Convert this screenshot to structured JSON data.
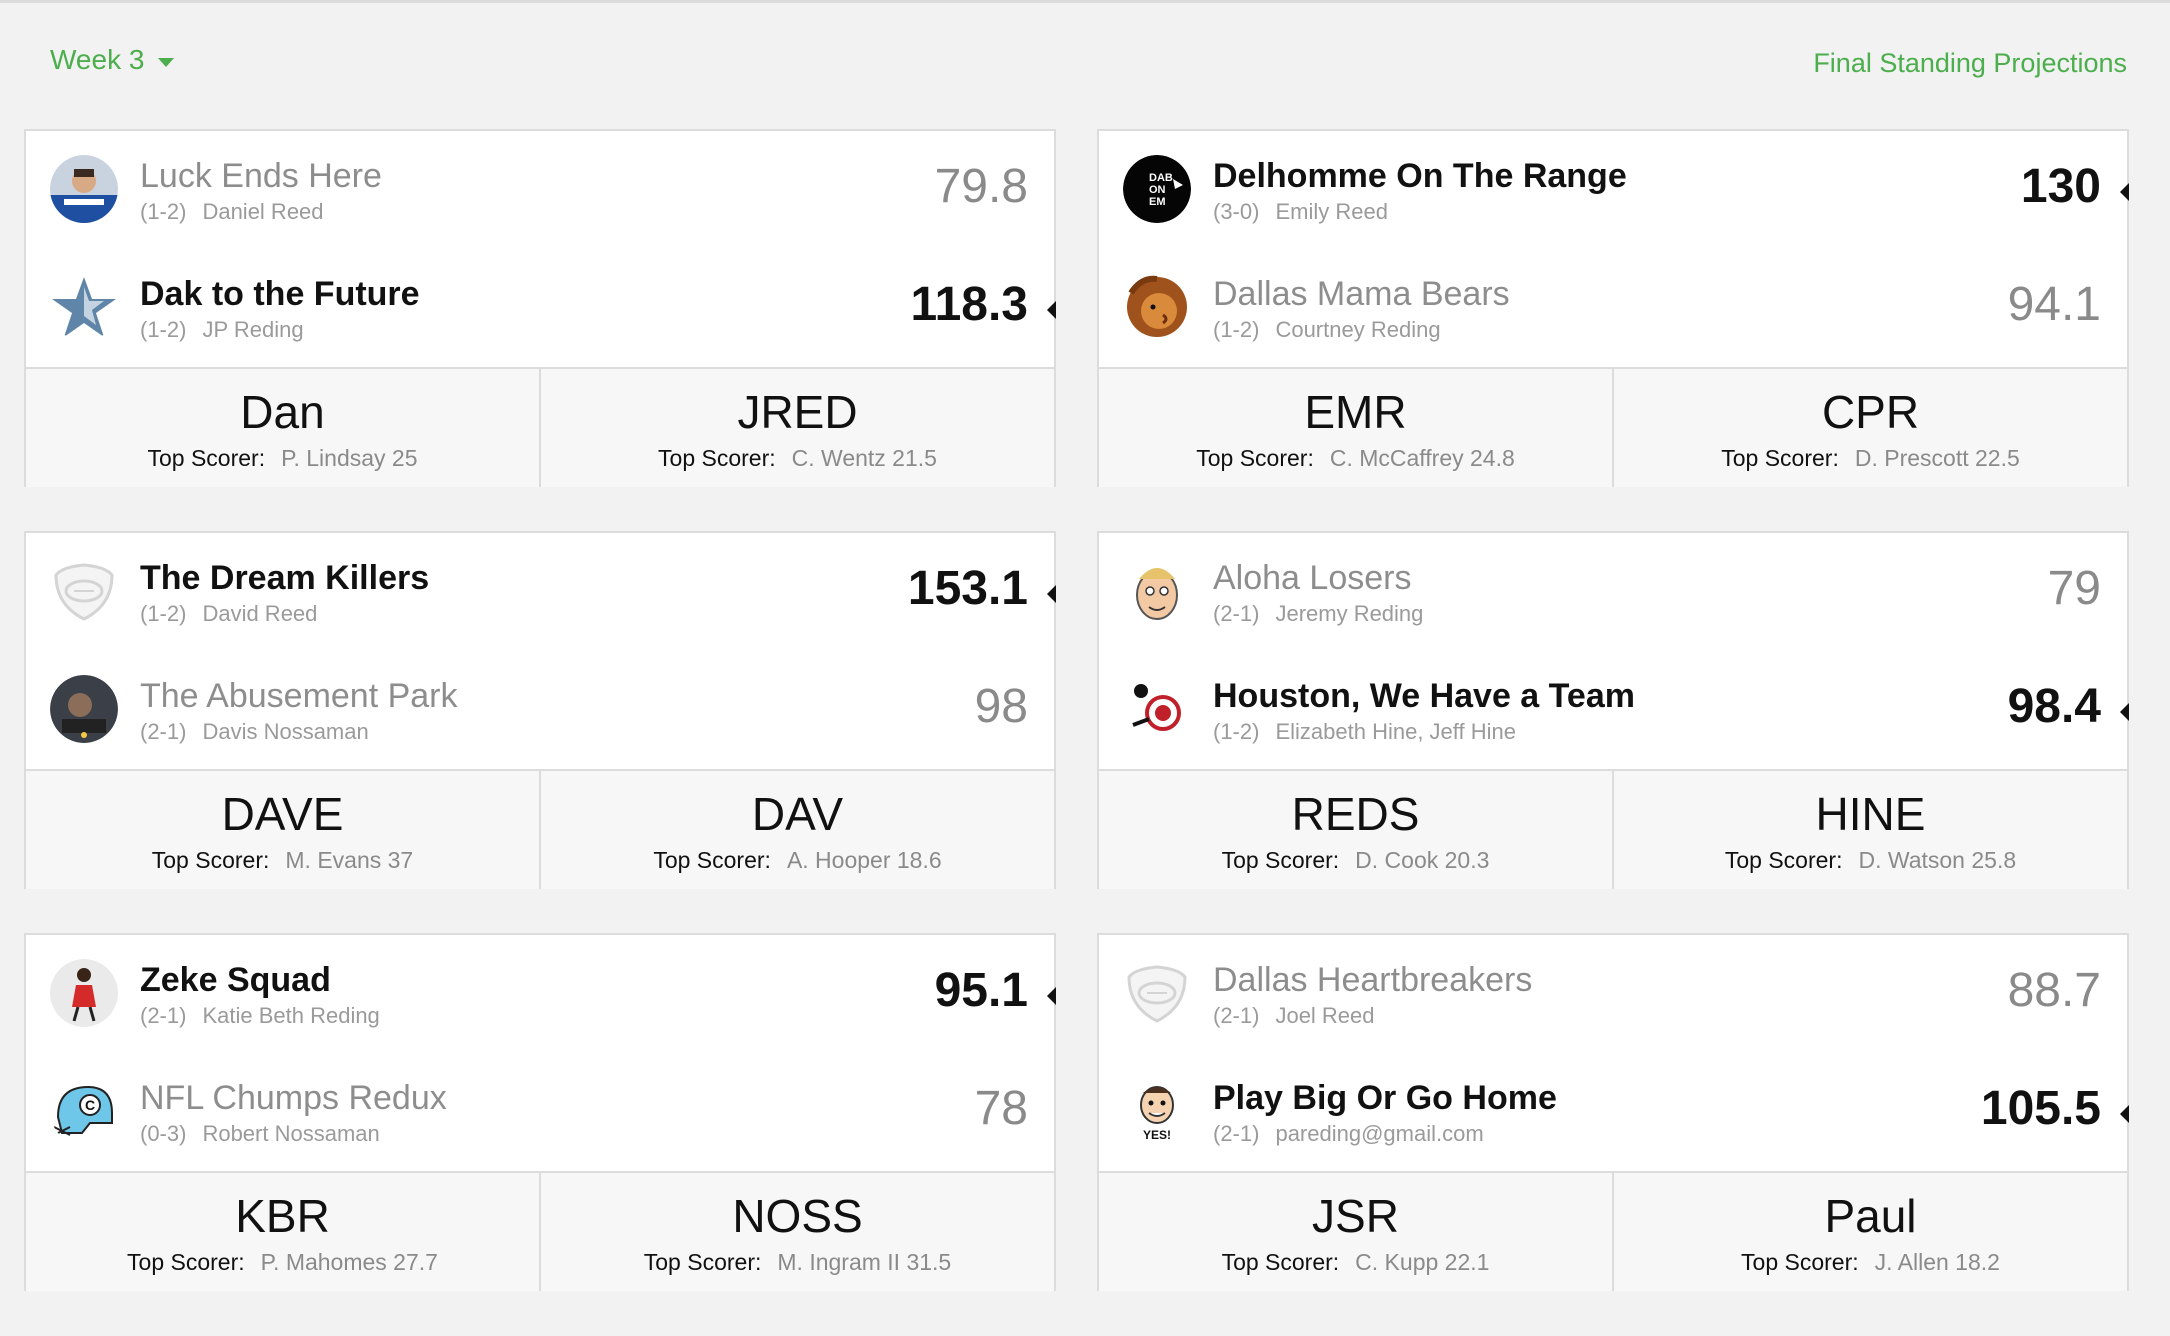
{
  "header": {
    "week_label": "Week 3",
    "projections_link": "Final Standing Projections"
  },
  "top_scorer_label": "Top Scorer:",
  "matchups": [
    {
      "team1": {
        "name": "Luck Ends Here",
        "record": "(1-2)",
        "owner": "Daniel Reed",
        "score": "79.8",
        "winner": false,
        "avatar": "quarterback-photo"
      },
      "team2": {
        "name": "Dak to the Future",
        "record": "(1-2)",
        "owner": "JP Reding",
        "score": "118.3",
        "winner": true,
        "avatar": "star-logo"
      },
      "footer1": {
        "abbr": "Dan",
        "top_scorer": "P. Lindsay 25"
      },
      "footer2": {
        "abbr": "JRED",
        "top_scorer": "C. Wentz 21.5"
      }
    },
    {
      "team1": {
        "name": "Delhomme On The Range",
        "record": "(3-0)",
        "owner": "Emily Reed",
        "score": "130",
        "winner": true,
        "avatar": "dab-on-em-logo"
      },
      "team2": {
        "name": "Dallas Mama Bears",
        "record": "(1-2)",
        "owner": "Courtney Reding",
        "score": "94.1",
        "winner": false,
        "avatar": "lion-logo"
      },
      "footer1": {
        "abbr": "EMR",
        "top_scorer": "C. McCaffrey 24.8"
      },
      "footer2": {
        "abbr": "CPR",
        "top_scorer": "D. Prescott 22.5"
      }
    },
    {
      "team1": {
        "name": "The Dream Killers",
        "record": "(1-2)",
        "owner": "David Reed",
        "score": "153.1",
        "winner": true,
        "avatar": "default-shield"
      },
      "team2": {
        "name": "The Abusement Park",
        "record": "(2-1)",
        "owner": "Davis Nossaman",
        "score": "98",
        "winner": false,
        "avatar": "ride-photo"
      },
      "footer1": {
        "abbr": "DAVE",
        "top_scorer": "M. Evans 37"
      },
      "footer2": {
        "abbr": "DAV",
        "top_scorer": "A. Hooper 18.6"
      }
    },
    {
      "team1": {
        "name": "Aloha Losers",
        "record": "(2-1)",
        "owner": "Jeremy Reding",
        "score": "79",
        "winner": false,
        "avatar": "cartoon-face"
      },
      "team2": {
        "name": "Houston, We Have a Team",
        "record": "(1-2)",
        "owner": "Elizabeth Hine, Jeff Hine",
        "score": "98.4",
        "winner": true,
        "avatar": "astronaut-logo"
      },
      "footer1": {
        "abbr": "REDS",
        "top_scorer": "D. Cook 20.3"
      },
      "footer2": {
        "abbr": "HINE",
        "top_scorer": "D. Watson 25.8"
      }
    },
    {
      "team1": {
        "name": "Zeke Squad",
        "record": "(2-1)",
        "owner": "Katie Beth Reding",
        "score": "95.1",
        "winner": true,
        "avatar": "dancer-figure"
      },
      "team2": {
        "name": "NFL Chumps Redux",
        "record": "(0-3)",
        "owner": "Robert Nossaman",
        "score": "78",
        "winner": false,
        "avatar": "helmet-logo"
      },
      "footer1": {
        "abbr": "KBR",
        "top_scorer": "P. Mahomes 27.7"
      },
      "footer2": {
        "abbr": "NOSS",
        "top_scorer": "M. Ingram II 31.5"
      }
    },
    {
      "team1": {
        "name": "Dallas Heartbreakers",
        "record": "(2-1)",
        "owner": "Joel Reed",
        "score": "88.7",
        "winner": false,
        "avatar": "default-shield"
      },
      "team2": {
        "name": "Play Big Or Go Home",
        "record": "(2-1)",
        "owner": "pareding@gmail.com",
        "score": "105.5",
        "winner": true,
        "avatar": "yes-cartoon"
      },
      "footer1": {
        "abbr": "JSR",
        "top_scorer": "C. Kupp 22.1"
      },
      "footer2": {
        "abbr": "Paul",
        "top_scorer": "J. Allen 18.2"
      }
    }
  ],
  "avatar_overlays": {
    "dab": "DAB\nON\nEM",
    "yes": "YES!",
    "helmet": "C"
  }
}
